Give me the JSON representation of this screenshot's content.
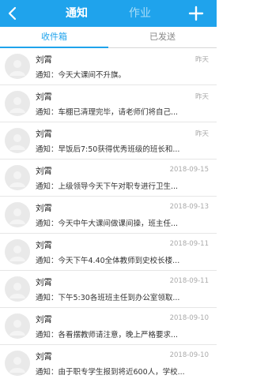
{
  "header": {
    "tabs": [
      {
        "label": "通知"
      },
      {
        "label": "作业"
      }
    ]
  },
  "subtabs": [
    {
      "label": "收件箱"
    },
    {
      "label": "已发送"
    }
  ],
  "colors": {
    "accent": "#1fa3ec"
  },
  "icons": {
    "back": "chevron-left-icon",
    "add": "plus-icon",
    "avatar": "user-avatar-icon"
  },
  "messages": [
    {
      "sender": "刘霄",
      "time": "昨天",
      "preview": "通知：今天大课间不升旗。"
    },
    {
      "sender": "刘霄",
      "time": "昨天",
      "preview": "通知：车棚已清理完毕，请老师们将自己..."
    },
    {
      "sender": "刘霄",
      "time": "昨天",
      "preview": "通知：早饭后7:50获得优秀班级的班长和..."
    },
    {
      "sender": "刘霄",
      "time": "2018-09-15",
      "preview": "通知：上级领导今天下午对职专进行卫生..."
    },
    {
      "sender": "刘霄",
      "time": "2018-09-13",
      "preview": "通知：今天中午大课间做课间操，班主任..."
    },
    {
      "sender": "刘霄",
      "time": "2018-09-11",
      "preview": "通知：今天下午4.40全体教师到史校长楼..."
    },
    {
      "sender": "刘霄",
      "time": "2018-09-11",
      "preview": "通知：下午5:30各班班主任到办公室领取..."
    },
    {
      "sender": "刘霄",
      "time": "2018-09-10",
      "preview": "通知：各看摆教师请注意，晚上严格要求..."
    },
    {
      "sender": "刘霄",
      "time": "2018-09-10",
      "preview": "通知：由于职专学生报到将近600人，学校..."
    }
  ]
}
